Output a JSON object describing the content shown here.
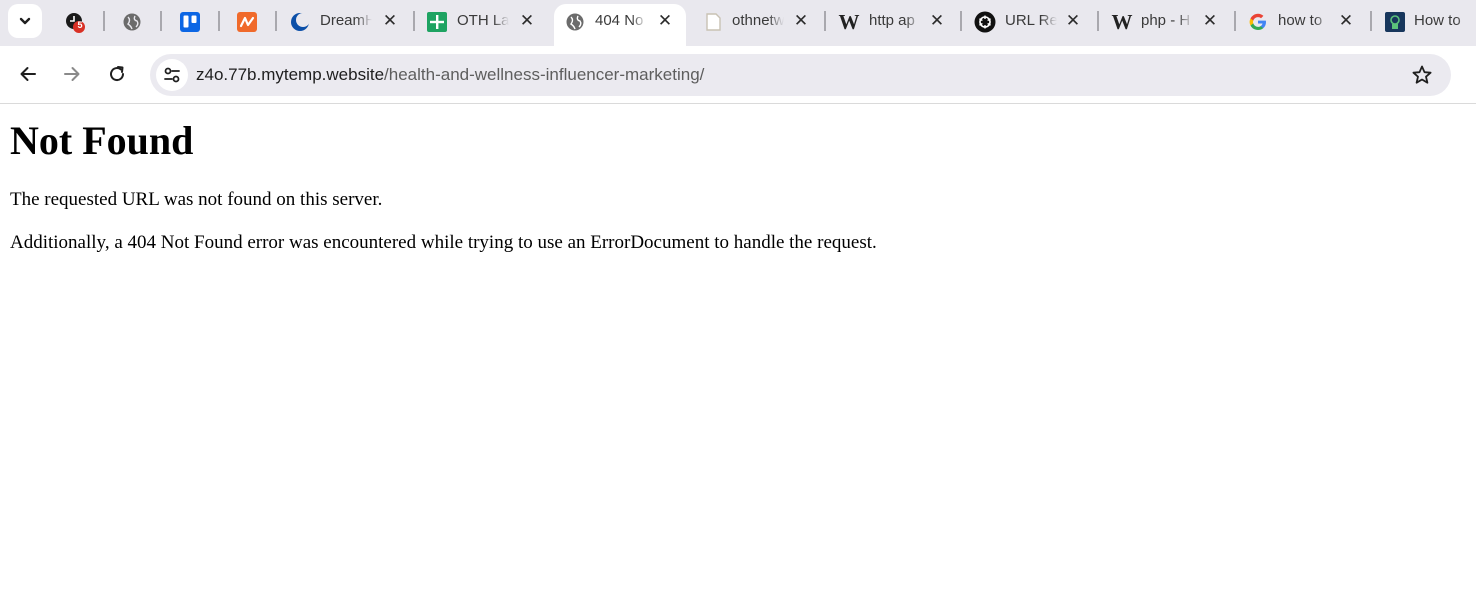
{
  "browser": {
    "tabs": [
      {
        "title": "",
        "icon": "clock-badge-icon",
        "badge": "5",
        "closable": false
      },
      {
        "title": "",
        "icon": "globe-icon",
        "closable": false
      },
      {
        "title": "",
        "icon": "trello-icon",
        "closable": false
      },
      {
        "title": "",
        "icon": "orange-wave-icon",
        "closable": false
      },
      {
        "title": "DreamH",
        "icon": "dreamhost-icon",
        "closable": true
      },
      {
        "title": "OTH La",
        "icon": "sheets-plus-icon",
        "closable": true
      },
      {
        "title": "404 No",
        "icon": "globe-icon",
        "closable": true,
        "active": true
      },
      {
        "title": "othnetw",
        "icon": "page-icon",
        "closable": true
      },
      {
        "title": "http ap",
        "icon": "wikipedia-icon",
        "closable": true
      },
      {
        "title": "URL Re",
        "icon": "openai-icon",
        "closable": true
      },
      {
        "title": "php - H",
        "icon": "wikipedia-icon",
        "closable": true
      },
      {
        "title": "how to",
        "icon": "google-icon",
        "closable": true
      },
      {
        "title": "How to",
        "icon": "dark-app-icon",
        "closable": false
      }
    ],
    "address": {
      "host": "z4o.77b.mytemp.website",
      "path": "/health-and-wellness-influencer-marketing/"
    },
    "colors": {
      "tabstrip": "#e9e8ee",
      "omnibox": "#ebeaf0",
      "badge": "#d93025",
      "trello": "#0c66e4",
      "sheets": "#1ea362",
      "orange": "#f06a2b"
    }
  },
  "page": {
    "heading": "Not Found",
    "message": "The requested URL was not found on this server.",
    "detail": "Additionally, a 404 Not Found error was encountered while trying to use an ErrorDocument to handle the request."
  }
}
